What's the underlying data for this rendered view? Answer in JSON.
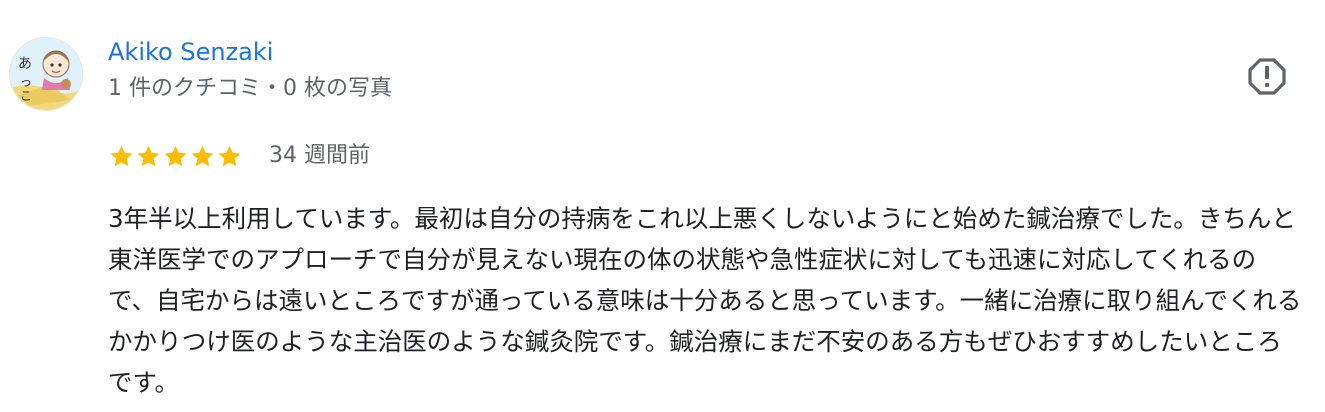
{
  "review": {
    "author_name": "Akiko Senzaki",
    "author_meta": "1 件のクチコミ・0 枚の写真",
    "rating": 5,
    "rating_max": 5,
    "time_ago": "34 週間前",
    "text": "3年半以上利用しています。最初は自分の持病をこれ以上悪くしないようにと始めた鍼治療でした。きちんと東洋医学でのアプローチで自分が見えない現在の体の状態や急性症状に対しても迅速に対応してくれるので、自宅からは遠いところですが通っている意味は十分あると思っています。一緒に治療に取り組んでくれるかかりつけ医のような主治医のような鍼灸院です。鍼治療にまだ不安のある方もぜひおすすめしたいところです。"
  },
  "icons": {
    "report": "report-flag-icon",
    "star": "star-icon",
    "avatar": "avatar-illustration"
  },
  "colors": {
    "author_link": "#1a73e8",
    "meta_text": "#5f6368",
    "body_text": "#202124",
    "star_fill": "#fbbc04",
    "icon_gray": "#5f6368"
  }
}
